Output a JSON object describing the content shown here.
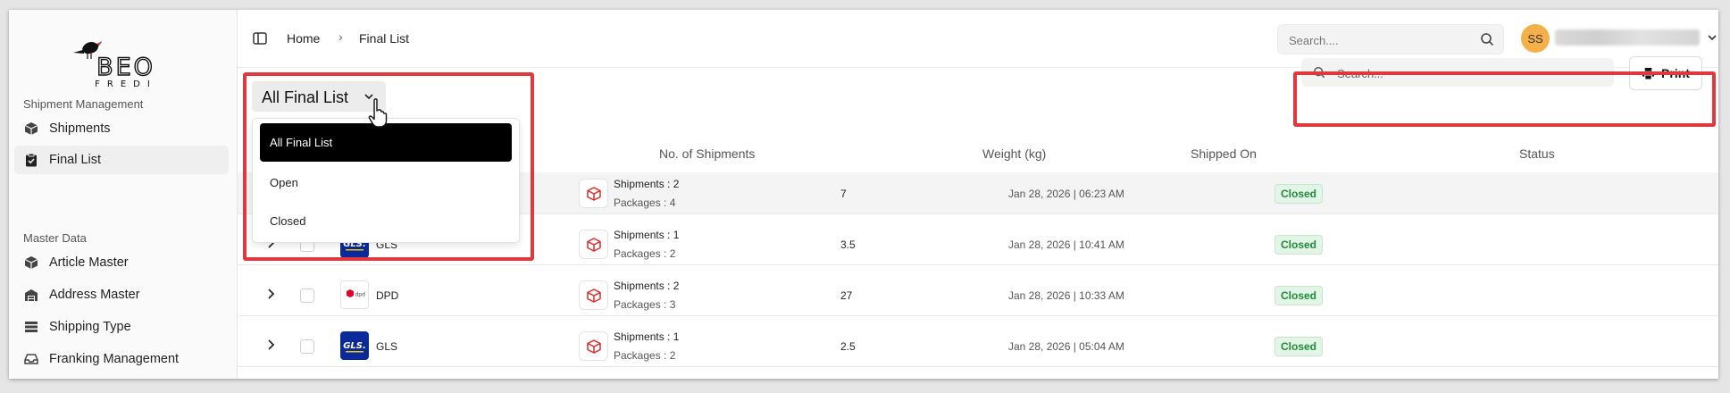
{
  "brand": {
    "logo_text": "BEO",
    "logo_subtext": "FREDI"
  },
  "sidebar": {
    "sections": [
      {
        "title": "Shipment Management",
        "items": [
          {
            "label": "Shipments",
            "icon": "box-icon"
          },
          {
            "label": "Final List",
            "icon": "clipboard-check-icon",
            "active": true
          }
        ]
      },
      {
        "title": "Master Data",
        "items": [
          {
            "label": "Article Master",
            "icon": "box-icon"
          },
          {
            "label": "Address Master",
            "icon": "warehouse-icon"
          },
          {
            "label": "Shipping Type",
            "icon": "layers-icon"
          },
          {
            "label": "Franking Management",
            "icon": "inbox-icon"
          }
        ]
      }
    ]
  },
  "header": {
    "breadcrumb": {
      "home": "Home",
      "separator": "›",
      "current": "Final List"
    },
    "search_placeholder": "Search....",
    "user_initials": "SS"
  },
  "toolbar": {
    "filter_label": "All Final List",
    "filter_options": [
      "All Final List",
      "Open",
      "Closed"
    ],
    "search_placeholder": "Search...",
    "print_label": "Print"
  },
  "table": {
    "columns": [
      "No. of Shipments",
      "Weight (kg)",
      "Shipped On",
      "Status"
    ],
    "rows": [
      {
        "carrier": "",
        "shipments": "Shipments : 2",
        "packages": "Packages : 4",
        "weight": "7",
        "shipped_on": "Jan 28, 2026 | 06:23 AM",
        "status": "Closed"
      },
      {
        "carrier": "GLS",
        "shipments": "Shipments : 1",
        "packages": "Packages : 2",
        "weight": "3.5",
        "shipped_on": "Jan 28, 2026 | 10:41 AM",
        "status": "Closed"
      },
      {
        "carrier": "DPD",
        "shipments": "Shipments : 2",
        "packages": "Packages : 3",
        "weight": "27",
        "shipped_on": "Jan 28, 2026 | 10:33 AM",
        "status": "Closed"
      },
      {
        "carrier": "GLS",
        "shipments": "Shipments : 1",
        "packages": "Packages : 2",
        "weight": "2.5",
        "shipped_on": "Jan 28, 2026 | 05:04 AM",
        "status": "Closed"
      }
    ]
  },
  "colors": {
    "highlight": "#e0383c",
    "status_green": "#218a3a",
    "avatar": "#f6b04a",
    "gls_blue": "#0a2a9c",
    "dpd_red": "#dc0032"
  }
}
